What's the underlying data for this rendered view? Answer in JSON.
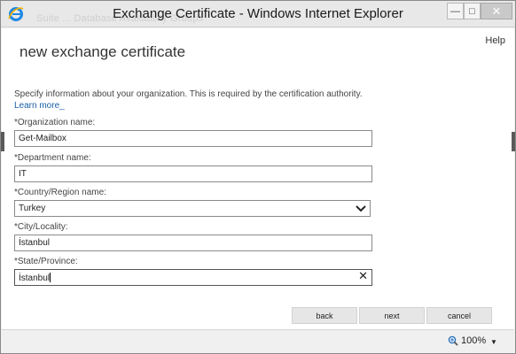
{
  "window": {
    "title": "Exchange Certificate - Windows Internet Explorer",
    "background_ghost_text": "Suite ... Database Availability Groups",
    "controls": {
      "minimize": "—",
      "maximize": "□",
      "close": "✕"
    }
  },
  "header": {
    "help_label": "Help"
  },
  "page": {
    "title": "new exchange certificate",
    "intro_text": "Specify information about your organization. This is required by the certification authority. ",
    "intro_link": "Learn more"
  },
  "form": {
    "organization": {
      "label": "*Organization name:",
      "value": "Get-Mailbox"
    },
    "department": {
      "label": "*Department name:",
      "value": "IT"
    },
    "country": {
      "label": "*Country/Region name:",
      "value": "Turkey"
    },
    "city": {
      "label": "*City/Locality:",
      "value": "İstanbul"
    },
    "state": {
      "label": "*State/Province:",
      "value": "İstanbul"
    }
  },
  "buttons": {
    "back": "back",
    "next": "next",
    "cancel": "cancel"
  },
  "statusbar": {
    "zoom": "100%"
  },
  "colors": {
    "link": "#1a5ea8",
    "ie_logo": "#1e88e5"
  }
}
